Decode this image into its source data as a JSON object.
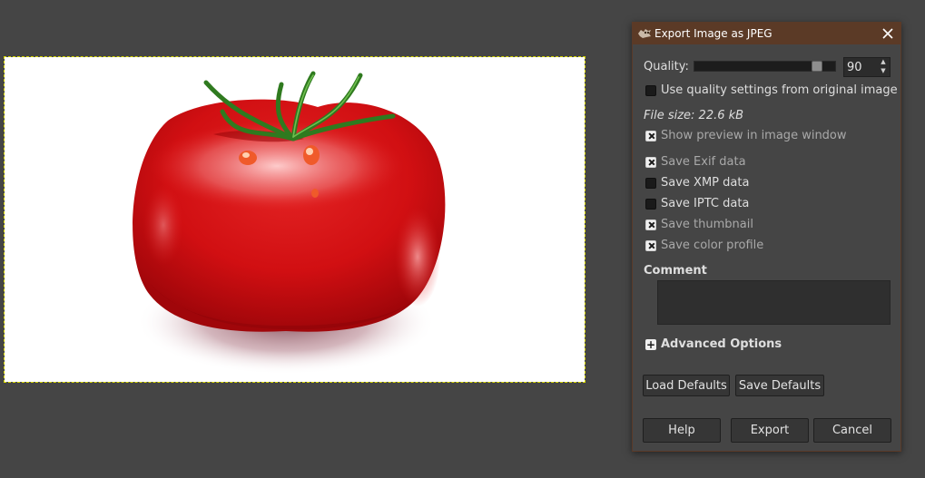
{
  "dialog": {
    "title": "Export Image as JPEG",
    "app_icon": "gimp-wilber-icon",
    "close_icon": "close-icon"
  },
  "quality": {
    "label": "Quality:",
    "value": "90",
    "slider_fraction": 0.9
  },
  "options": {
    "use_original_quality": {
      "label": "Use quality settings from original image",
      "checked": false
    },
    "file_size": "File size: 22.6 kB",
    "show_preview": {
      "label": "Show preview in image window",
      "checked": true
    },
    "save_exif": {
      "label": "Save Exif data",
      "checked": true
    },
    "save_xmp": {
      "label": "Save XMP data",
      "checked": false
    },
    "save_iptc": {
      "label": "Save IPTC data",
      "checked": false
    },
    "save_thumbnail": {
      "label": "Save thumbnail",
      "checked": true
    },
    "save_color_profile": {
      "label": "Save color profile",
      "checked": true
    }
  },
  "comment": {
    "label": "Comment",
    "value": ""
  },
  "advanced": {
    "label": "Advanced Options",
    "expanded": false
  },
  "buttons": {
    "load_defaults": "Load Defaults",
    "save_defaults": "Save Defaults",
    "help": "Help",
    "export": "Export",
    "cancel": "Cancel"
  },
  "canvas": {
    "image_subject": "red tomato"
  }
}
